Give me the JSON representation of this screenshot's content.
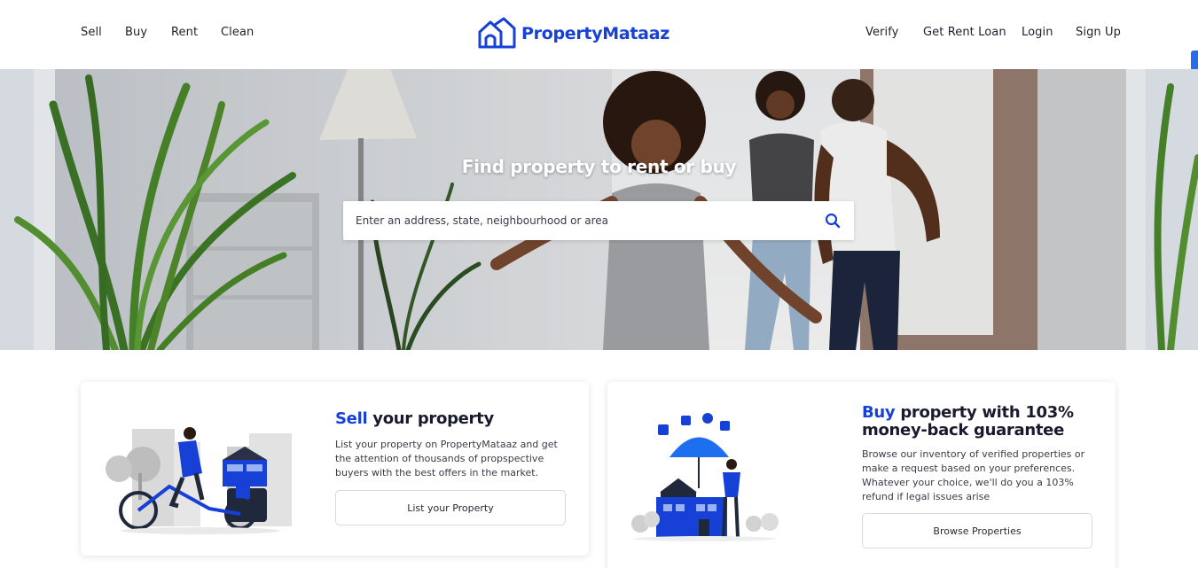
{
  "nav": {
    "left_links": [
      "Sell",
      "Buy",
      "Rent",
      "Clean"
    ],
    "right_links": [
      "Verify",
      "Get Rent Loan",
      "Login",
      "Sign Up"
    ],
    "logo_text": "PropertyMataaz",
    "logo_icon": "house-outline-icon"
  },
  "hero": {
    "title": "Find property to rent or buy",
    "search": {
      "placeholder": "Enter an address, state, neighbourhood or area",
      "value": "",
      "icon": "search-icon"
    }
  },
  "cards": {
    "sell": {
      "title_accent": "Sell",
      "title_rest": " your property",
      "description": "List your property on PropertyMataaz and get the attention of thousands of propspective buyers with the best offers in the market.",
      "button_label": "List your Property"
    },
    "buy": {
      "title_accent": "Buy",
      "title_rest": " property with 103% money-back guarantee",
      "description": "Browse our inventory of verified properties or make a request based on your preferences. Whatever your choice, we'll do you a 103% refund if legal issues arise",
      "button_label": "Browse Properties"
    }
  },
  "colors": {
    "brand": "#1640d6",
    "text": "#1a1a2e",
    "scrollbar": "#2b6be8"
  }
}
